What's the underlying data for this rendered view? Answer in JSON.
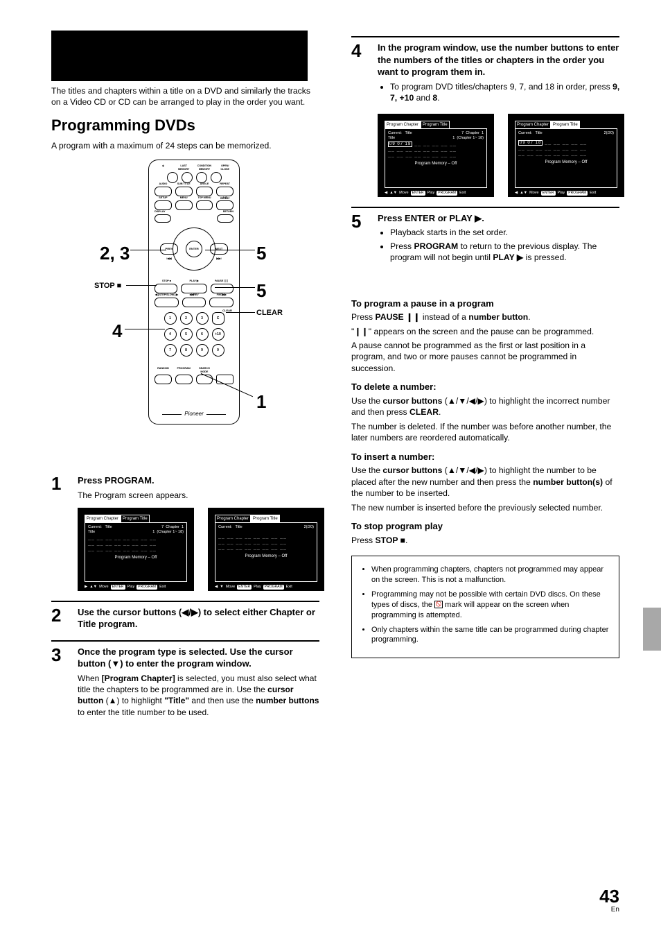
{
  "intro": "The titles and chapters within a title on a DVD and similarly the tracks on a Video CD or CD can be arranged to play in the order you want.",
  "heading": "Programming DVDs",
  "sub_intro": "A program with a maximum of 24 steps can be memorized.",
  "remote_callouts": {
    "left1": "2, 3",
    "stop": "STOP ■",
    "left2": "4",
    "right1": "5",
    "right2": "5",
    "clear": "CLEAR",
    "bottom": "1"
  },
  "steps_left": [
    {
      "num": "1",
      "title": "Press PROGRAM.",
      "text": "The Program screen appears."
    },
    {
      "num": "2",
      "title": "Use the cursor buttons (◀/▶) to select either Chapter or Title program."
    },
    {
      "num": "3",
      "title": "Once the program type is selected. Use the cursor button (▼) to enter the program window.",
      "text": "When [Program Chapter] is selected, you must also select what title the chapters to be programmed are in. Use the cursor button (▲) to highlight \"Title\" and then use the number buttons to enter the title number to be used."
    }
  ],
  "steps_right": [
    {
      "num": "4",
      "title": "In the program window, use the number buttons to enter the numbers of the titles or chapters in the order you want to program them in.",
      "bullets": [
        "To program DVD titles/chapters 9, 7, and 18 in order, press 9, 7, +10 and 8."
      ]
    },
    {
      "num": "5",
      "title": "Press ENTER or PLAY ▶.",
      "bullets": [
        "Playback starts in the set order.",
        "Press PROGRAM to return to the previous display. The program will not begin until PLAY ▶ is pressed."
      ]
    }
  ],
  "subsections": {
    "pause": {
      "h": "To program a pause in a program",
      "l1": "Press PAUSE ❙❙ instead of a number button.",
      "l2": "\"❙❙\" appears on the screen and the pause can be programmed.",
      "l3": "A pause cannot be programmed as the first or last position in a program, and two or more pauses cannot be programmed in succession."
    },
    "delete": {
      "h": "To delete a number:",
      "l1": "Use the cursor buttons (▲/▼/◀/▶) to highlight the incorrect number and then press CLEAR.",
      "l2": "The number is deleted. If the number was before another number, the later numbers are reordered automatically."
    },
    "insert": {
      "h": "To insert a number:",
      "l1": "Use the cursor buttons (▲/▼/◀/▶) to highlight the number to be placed after the new number and then press the number button(s) of the number to be inserted.",
      "l2": "The new number is inserted before the previously selected number."
    },
    "stop": {
      "h": "To stop program play",
      "l1": "Press STOP ■."
    }
  },
  "notes": [
    "When programming chapters, chapters not programmed may appear on the screen. This is not a malfunction.",
    "Programming may not be possible with certain DVD discs. On these types of discs, the  mark will appear on the screen when programming is attempted.",
    "Only chapters within the same title can be programmed during chapter programming."
  ],
  "osd": {
    "tab_chapter": "Program Chapter",
    "tab_title": "Program Title",
    "current_label": "Current:",
    "title_label": "Title",
    "title_current": "7",
    "chapter_label": "Chapter",
    "chapter_current": "1",
    "title_value": "1",
    "chapter_range": "(Chapter 1~ 18)",
    "title_total": "2(/20)",
    "entered": "09  07  18",
    "pm_off": "Program Memory – Off",
    "move": "Move",
    "enter": "ENTER",
    "play": "Play",
    "program": "PROGRAM",
    "exit": "Exit"
  },
  "page_number": "43",
  "page_lang": "En"
}
